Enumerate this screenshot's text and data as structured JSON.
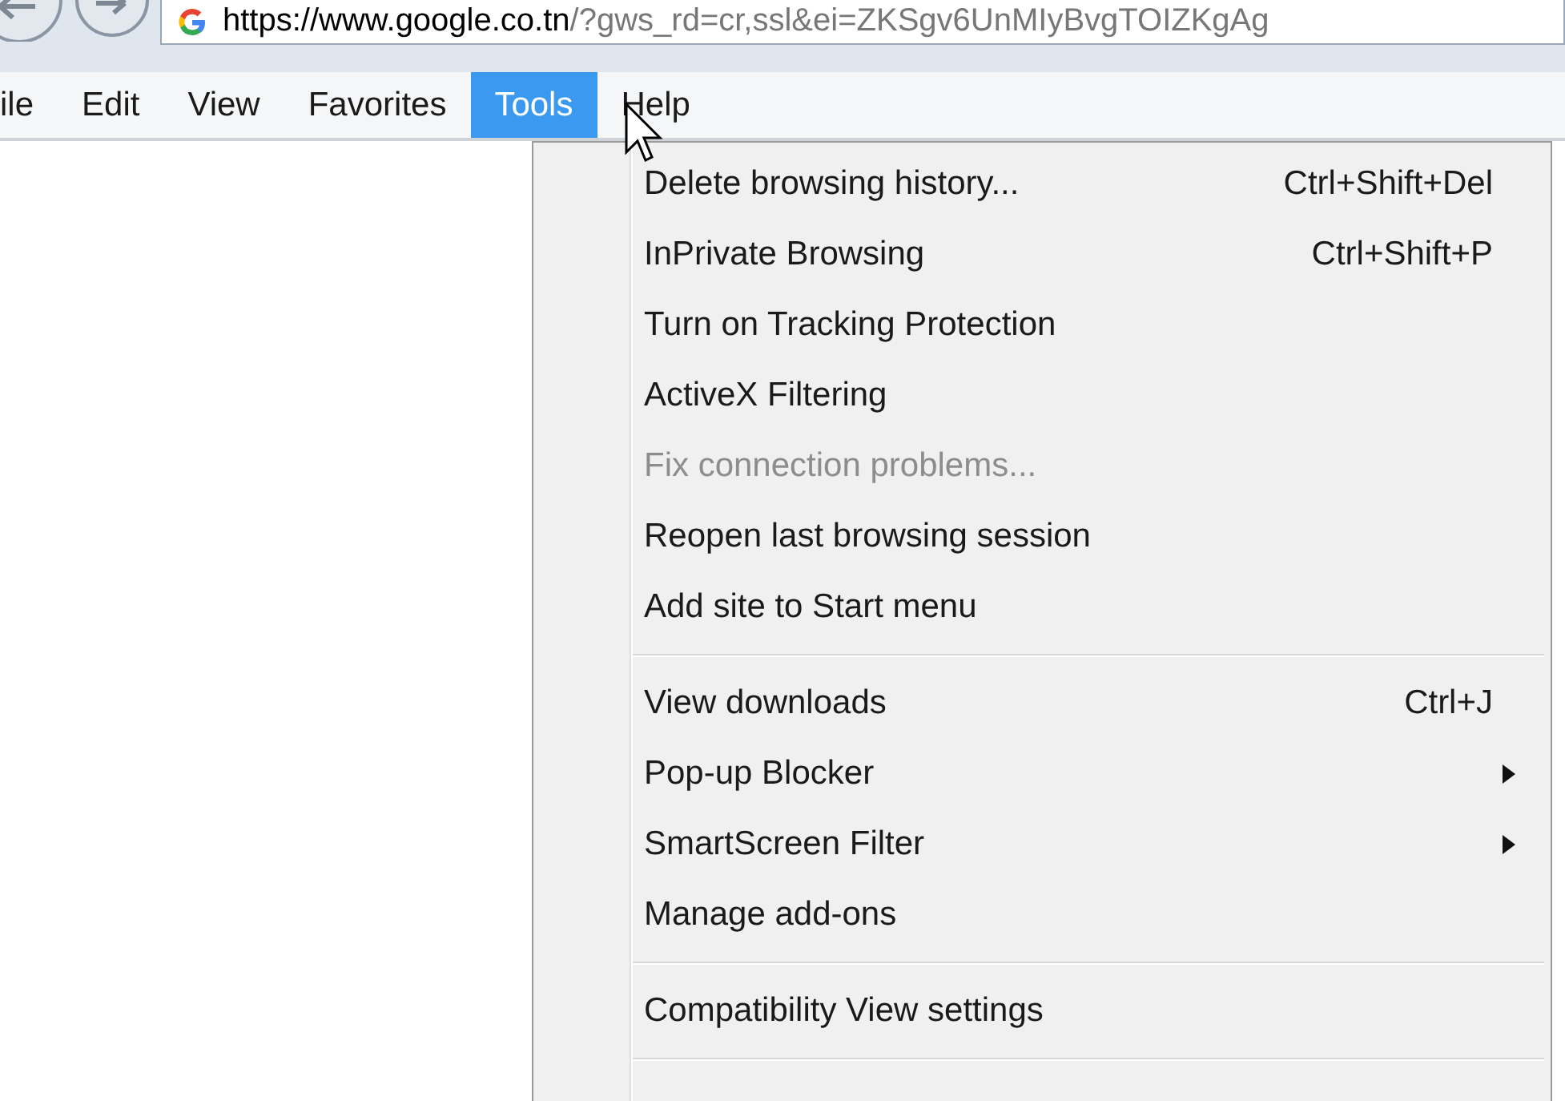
{
  "address_bar": {
    "url_host": "https://www.google.co.tn",
    "url_rest": "/?gws_rd=cr,ssl&ei=ZKSgv6UnMIyBvgTOIZKgAg"
  },
  "menu_bar": [
    {
      "label": "ile",
      "selected": false
    },
    {
      "label": "Edit",
      "selected": false
    },
    {
      "label": "View",
      "selected": false
    },
    {
      "label": "Favorites",
      "selected": false
    },
    {
      "label": "Tools",
      "selected": true
    },
    {
      "label": "Help",
      "selected": false
    }
  ],
  "tools_menu": [
    {
      "kind": "item",
      "label": "Delete browsing history...",
      "shortcut": "Ctrl+Shift+Del",
      "disabled": false,
      "submenu": false
    },
    {
      "kind": "item",
      "label": "InPrivate Browsing",
      "shortcut": "Ctrl+Shift+P",
      "disabled": false,
      "submenu": false
    },
    {
      "kind": "item",
      "label": "Turn on Tracking Protection",
      "disabled": false,
      "submenu": false
    },
    {
      "kind": "item",
      "label": "ActiveX Filtering",
      "disabled": false,
      "submenu": false
    },
    {
      "kind": "item",
      "label": "Fix connection problems...",
      "disabled": true,
      "submenu": false
    },
    {
      "kind": "item",
      "label": "Reopen last browsing session",
      "disabled": false,
      "submenu": false
    },
    {
      "kind": "item",
      "label": "Add site to Start menu",
      "disabled": false,
      "submenu": false
    },
    {
      "kind": "separator"
    },
    {
      "kind": "item",
      "label": "View downloads",
      "shortcut": "Ctrl+J",
      "disabled": false,
      "submenu": false
    },
    {
      "kind": "item",
      "label": "Pop-up Blocker",
      "disabled": false,
      "submenu": true
    },
    {
      "kind": "item",
      "label": "SmartScreen Filter",
      "disabled": false,
      "submenu": true
    },
    {
      "kind": "item",
      "label": "Manage add-ons",
      "disabled": false,
      "submenu": false
    },
    {
      "kind": "separator"
    },
    {
      "kind": "item",
      "label": "Compatibility View settings",
      "disabled": false,
      "submenu": false
    },
    {
      "kind": "separator"
    }
  ]
}
